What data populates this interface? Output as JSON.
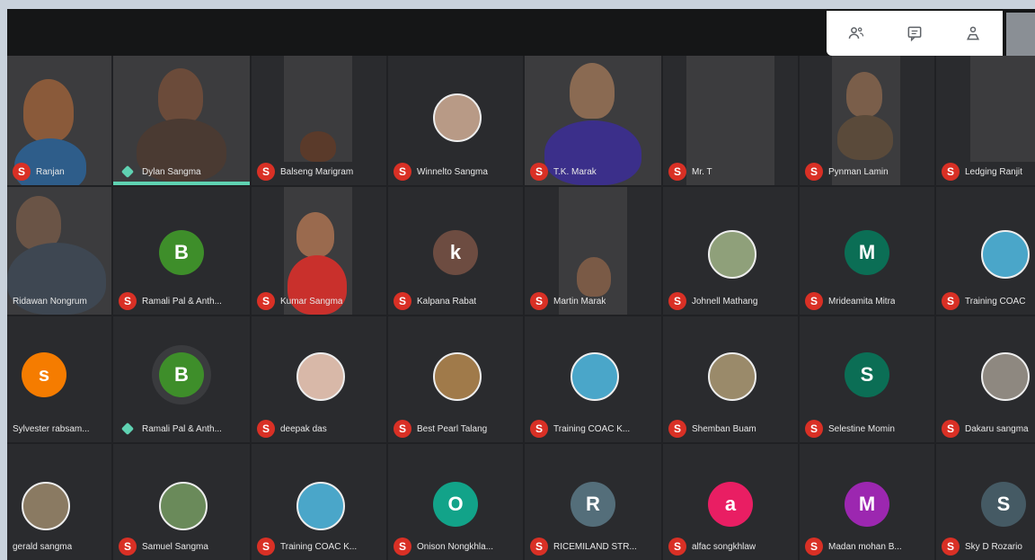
{
  "toolbar": {
    "icons": [
      "people-icon",
      "chat-icon",
      "activities-icon"
    ]
  },
  "participants": {
    "row1": [
      {
        "name": "Ranjan",
        "mic": "muted"
      },
      {
        "name": "Dylan Sangma",
        "mic": "on"
      },
      {
        "name": "Balseng Marigram",
        "mic": "muted"
      },
      {
        "name": "Winnelto Sangma",
        "mic": "muted"
      },
      {
        "name": "T.K. Marak",
        "mic": "muted"
      },
      {
        "name": "Mr. T",
        "mic": "muted"
      },
      {
        "name": "Pynman Lamin",
        "mic": "muted"
      },
      {
        "name": "Ledging Ranjit",
        "mic": "muted"
      }
    ],
    "row2": [
      {
        "name": "Ridawan Nongrum",
        "mic": "muted"
      },
      {
        "name": "Ramali Pal & Anth...",
        "mic": "muted",
        "initial": "B"
      },
      {
        "name": "Kumar Sangma",
        "mic": "muted"
      },
      {
        "name": "Kalpana Rabat",
        "mic": "muted",
        "initial": "k"
      },
      {
        "name": "Martin Marak",
        "mic": "muted"
      },
      {
        "name": "Johnell Mathang",
        "mic": "muted"
      },
      {
        "name": "Mrideamita Mitra",
        "mic": "muted",
        "initial": "M"
      },
      {
        "name": "Training COAC",
        "mic": "muted"
      }
    ],
    "row3": [
      {
        "name": "Sylvester rabsam...",
        "mic": "muted",
        "initial": "s"
      },
      {
        "name": "Ramali Pal & Anth...",
        "mic": "on",
        "initial": "B"
      },
      {
        "name": "deepak das",
        "mic": "muted"
      },
      {
        "name": "Best Pearl Talang",
        "mic": "muted"
      },
      {
        "name": "Training COAC K...",
        "mic": "muted"
      },
      {
        "name": "Shemban Buam",
        "mic": "muted"
      },
      {
        "name": "Selestine Momin",
        "mic": "muted",
        "initial": "S"
      },
      {
        "name": "Dakaru sangma",
        "mic": "muted"
      }
    ],
    "row4": [
      {
        "name": "gerald sangma",
        "mic": "muted"
      },
      {
        "name": "Samuel Sangma",
        "mic": "muted"
      },
      {
        "name": "Training COAC K...",
        "mic": "muted"
      },
      {
        "name": "Onison Nongkhla...",
        "mic": "muted",
        "initial": "O"
      },
      {
        "name": "RICEMILAND STR...",
        "mic": "muted",
        "initial": "R"
      },
      {
        "name": "alfac songkhlaw",
        "mic": "muted",
        "initial": "a"
      },
      {
        "name": "Madan mohan B...",
        "mic": "muted",
        "initial": "M"
      },
      {
        "name": "Sky D Rozario",
        "mic": "muted",
        "initial": "S"
      }
    ]
  },
  "mic_muted_glyph": "S",
  "colors": {
    "background": "#202124",
    "tile": "#2a2b2e",
    "mic_muted": "#d93025",
    "active_speaker": "#5fd2b2",
    "avatar_green": "#3e8e2a",
    "avatar_brown": "#6d4c41",
    "avatar_teal": "#0b6e55",
    "avatar_orange": "#f57c00",
    "avatar_cyan": "#12a389",
    "avatar_slate": "#546e7a",
    "avatar_pink": "#e91e63",
    "avatar_purple": "#9c27b0",
    "avatar_bluegrey": "#455a64"
  }
}
